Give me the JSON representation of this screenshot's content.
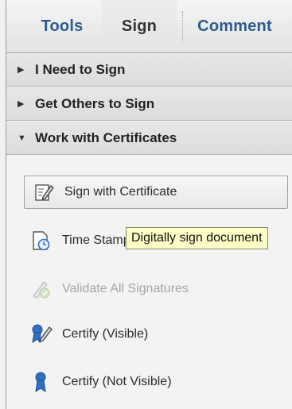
{
  "tabs": [
    {
      "label": "Tools"
    },
    {
      "label": "Sign"
    },
    {
      "label": "Comment"
    }
  ],
  "panels": [
    {
      "label": "I Need to Sign",
      "expanded": false
    },
    {
      "label": "Get Others to Sign",
      "expanded": false
    },
    {
      "label": "Work with Certificates",
      "expanded": true
    }
  ],
  "tools": [
    {
      "label": "Sign with Certificate",
      "icon": "pen-on-document-icon",
      "state": "hovered"
    },
    {
      "label": "Time Stamp Document",
      "icon": "clock-document-icon",
      "state": "normal"
    },
    {
      "label": "Validate All Signatures",
      "icon": "validate-signatures-icon",
      "state": "disabled"
    },
    {
      "label": "Certify (Visible)",
      "icon": "ribbon-pen-icon",
      "state": "normal"
    },
    {
      "label": "Certify (Not Visible)",
      "icon": "ribbon-icon",
      "state": "normal"
    }
  ],
  "tooltip": {
    "text": "Digitally sign document"
  },
  "colors": {
    "tab_text": "#2e5a8c",
    "tooltip_bg": "#fdfdc6",
    "ribbon": "#2f6fc4"
  }
}
